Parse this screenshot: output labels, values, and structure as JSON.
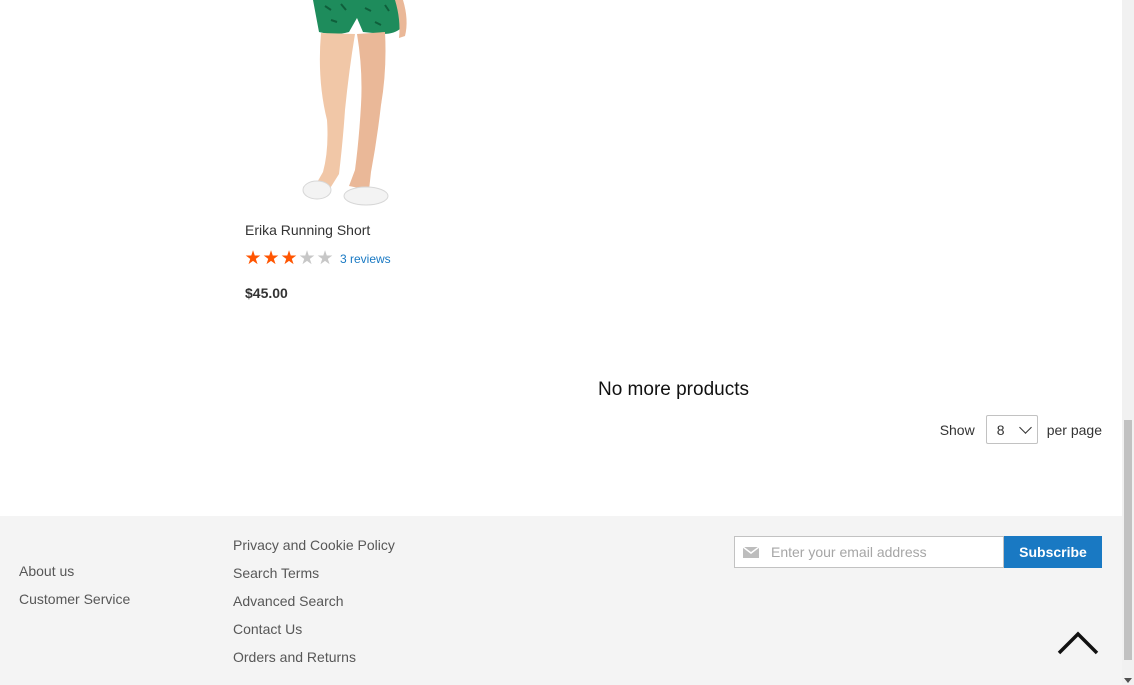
{
  "product": {
    "name": "Erika Running Short",
    "rating": {
      "value": 3,
      "max": 5
    },
    "reviews_label": "3 reviews",
    "price": "$45.00"
  },
  "listing": {
    "no_more_text": "No more products",
    "limiter": {
      "show_label": "Show",
      "selected": "8",
      "per_page_label": "per page"
    }
  },
  "footer": {
    "links_col1": [
      "About us",
      "Customer Service"
    ],
    "links_col2": [
      "Privacy and Cookie Policy",
      "Search Terms",
      "Advanced Search",
      "Contact Us",
      "Orders and Returns"
    ],
    "newsletter": {
      "placeholder": "Enter your email address",
      "button_label": "Subscribe"
    }
  },
  "colors": {
    "star": "#ff5501",
    "link": "#1979c3",
    "subscribe": "#1979c3",
    "footer_bg": "#f4f4f4"
  },
  "icons": {
    "mail": "envelope-icon",
    "back_to_top": "chevron-up-icon"
  }
}
